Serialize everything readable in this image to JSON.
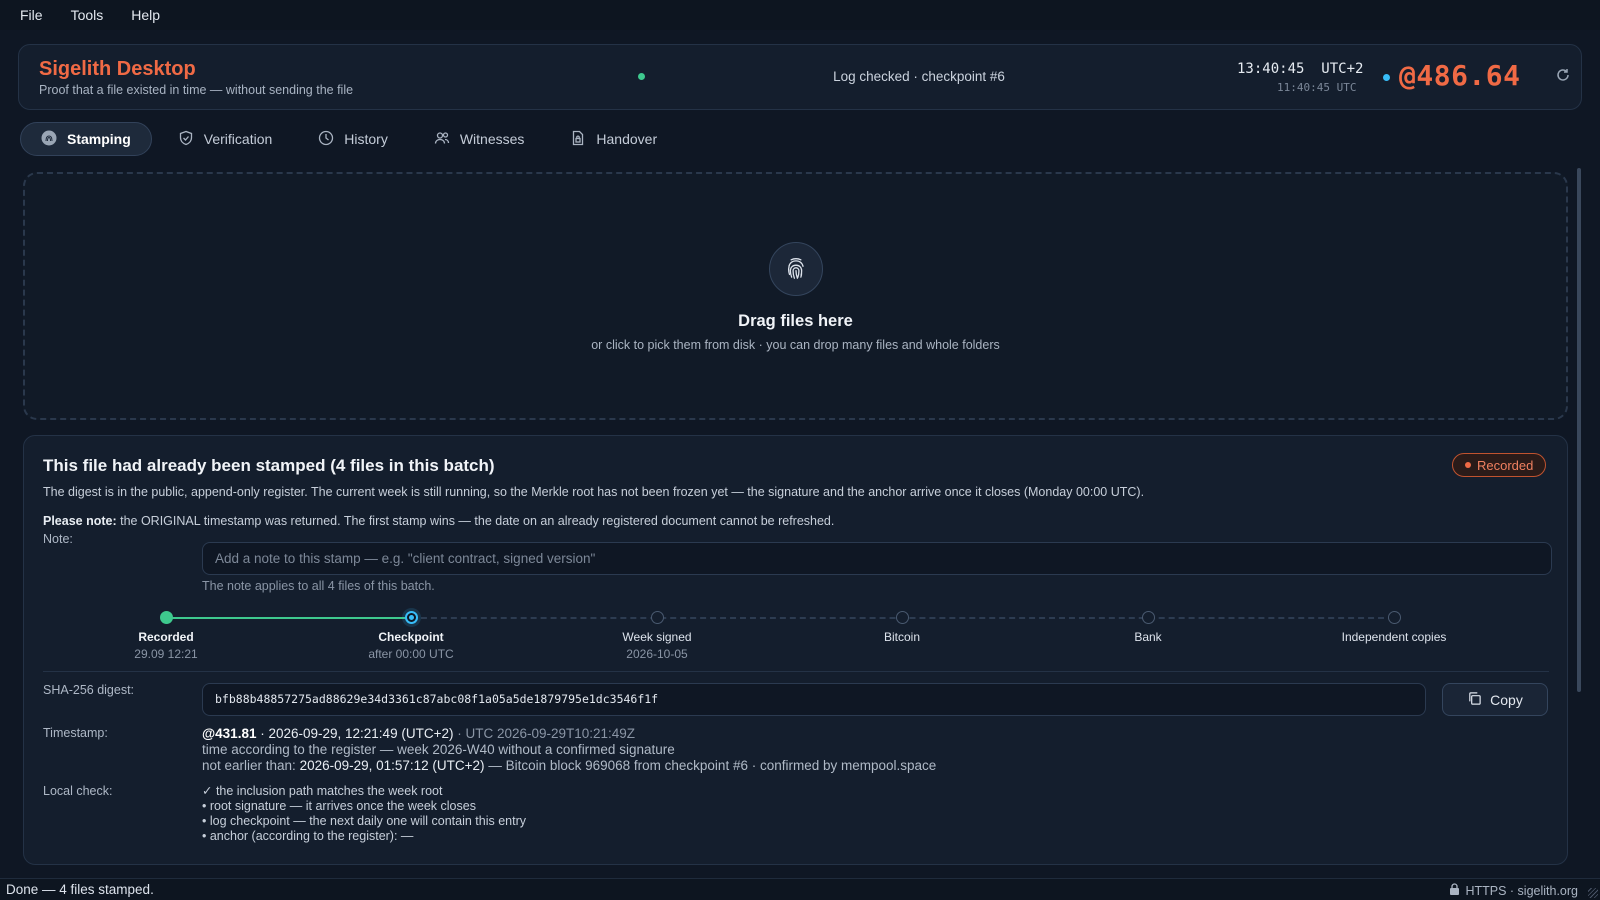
{
  "menu": {
    "file": "File",
    "tools": "Tools",
    "help": "Help"
  },
  "header": {
    "title": "Sigelith Desktop",
    "subtitle": "Proof that a file existed in time — without sending the file",
    "log_status": "Log checked · checkpoint #6",
    "local_time": "13:40:45",
    "local_zone": "UTC+2",
    "utc_time": "11:40:45 UTC",
    "beat": "@486.64",
    "colors": {
      "accent": "#f06a45",
      "ok": "#3ec98e",
      "info": "#38bdf8"
    }
  },
  "tabs": [
    {
      "label": "Stamping",
      "icon": "fingerprint-icon",
      "active": true
    },
    {
      "label": "Verification",
      "icon": "shield-check-icon"
    },
    {
      "label": "History",
      "icon": "clock-icon"
    },
    {
      "label": "Witnesses",
      "icon": "users-icon"
    },
    {
      "label": "Handover",
      "icon": "document-lock-icon"
    }
  ],
  "dropzone": {
    "title": "Drag files here",
    "subtitle": "or click to pick them from disk · you can drop many files and whole folders"
  },
  "result": {
    "title": "This file had already been stamped (4 files in this batch)",
    "badge": "Recorded",
    "description": "The digest is in the public, append-only register. The current week is still running, so the Merkle root has not been frozen yet — the signature and the anchor arrive once it closes (Monday 00:00 UTC).",
    "note_strong": "Please note:",
    "note_text": " the ORIGINAL timestamp was returned. The first stamp wins — the date on an already registered document cannot be refreshed.",
    "note_label": "Note:",
    "note_placeholder": "Add a note to this stamp — e.g. \"client contract, signed version\"",
    "note_hint": "The note applies to all 4 files of this batch.",
    "timeline": [
      {
        "name": "Recorded",
        "sub": "29.09 12:21",
        "state": "done"
      },
      {
        "name": "Checkpoint",
        "sub": "after 00:00 UTC",
        "state": "current"
      },
      {
        "name": "Week signed",
        "sub": "2026-10-05",
        "state": "pending"
      },
      {
        "name": "Bitcoin",
        "sub": "",
        "state": "pending"
      },
      {
        "name": "Bank",
        "sub": "",
        "state": "pending"
      },
      {
        "name": "Independent copies",
        "sub": "",
        "state": "pending"
      }
    ],
    "digest_label": "SHA-256 digest:",
    "digest": "bfb88b48857275ad88629e34d3361c87abc08f1a05a5de1879795e1dc3546f1f",
    "copy_label": "Copy",
    "timestamp_label": "Timestamp:",
    "ts_beat": "@431.81",
    "ts_local": " · 2026-09-29, 12:21:49 (UTC+2)",
    "ts_utc": " · UTC 2026-09-29T10:21:49Z",
    "ts_register": "time according to the register — week 2026-W40 without a confirmed signature",
    "ts_not_earlier_prefix": "not earlier than: ",
    "ts_not_earlier_value": "2026-09-29, 01:57:12 (UTC+2)",
    "ts_not_earlier_suffix": " — Bitcoin block 969068 from checkpoint #6 · confirmed by mempool.space",
    "local_check_label": "Local check:",
    "checks": [
      "✓ the inclusion path matches the week root",
      "• root signature — it arrives once the week closes",
      "• log checkpoint — the next daily one will contain this entry",
      "• anchor (according to the register): —"
    ]
  },
  "statusbar": {
    "text": "Done — 4 files stamped.",
    "connection": "HTTPS · sigelith.org"
  }
}
